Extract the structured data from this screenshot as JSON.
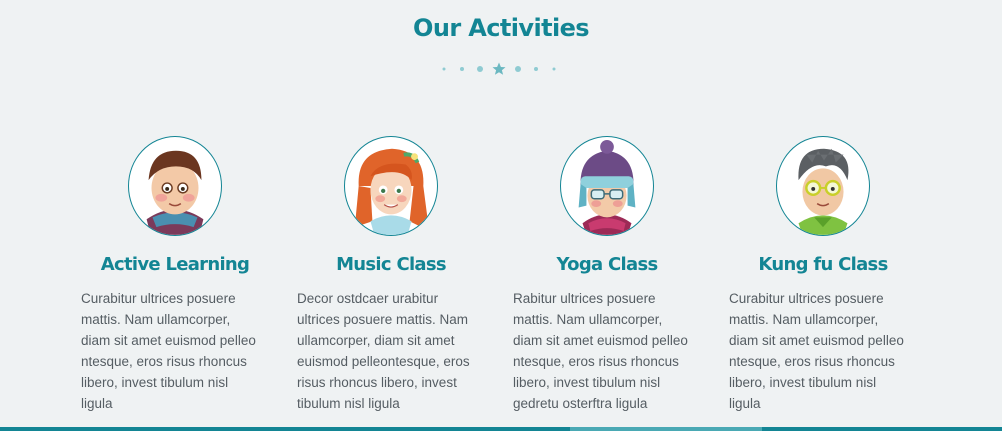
{
  "section": {
    "title": "Our Activities"
  },
  "colors": {
    "accent": "#138594",
    "divider": "#8fcbd2",
    "background": "#eff2f3",
    "text": "#555d63"
  },
  "activities": [
    {
      "title": "Active Learning",
      "description": "Curabitur ultrices posuere\nmattis. Nam ullamcorper,\ndiam sit amet euismod pelleo\nntesque, eros risus rhoncus\nlibero, invest tibulum nisl\nligula",
      "avatar_icon": "boy-with-scarf-avatar"
    },
    {
      "title": "Music Class",
      "description": "Decor ostdcaer urabitur\nultrices posuere mattis. Nam\nullamcorper, diam sit amet\neuismod pelleontesque, eros\nrisus rhoncus libero, invest\ntibulum nisl ligula",
      "avatar_icon": "red-haired-girl-avatar"
    },
    {
      "title": "Yoga Class",
      "description": "Rabitur ultrices posuere\nmattis. Nam ullamcorper,\ndiam sit amet euismod pelleo\nntesque, eros risus rhoncus\nlibero, invest tibulum nisl\ngedretu osterftra ligula",
      "avatar_icon": "girl-with-winter-hat-avatar"
    },
    {
      "title": "Kung fu Class",
      "description": "Curabitur ultrices posuere\nmattis. Nam ullamcorper,\ndiam sit amet euismod pelleo\nntesque, eros risus rhoncus\nlibero, invest tibulum nisl\nligula",
      "avatar_icon": "boy-with-glasses-avatar"
    }
  ]
}
